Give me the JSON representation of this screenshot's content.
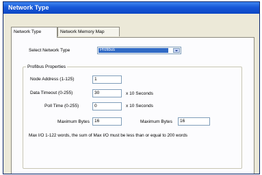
{
  "window": {
    "title": "Network Type"
  },
  "tabs": [
    {
      "label": "Network Type",
      "active": true
    },
    {
      "label": "Network Memory Map",
      "active": false
    }
  ],
  "select_network": {
    "label": "Select Network Type",
    "value": "Profibus"
  },
  "group": {
    "title": "Profibus Properties"
  },
  "fields": {
    "node_address": {
      "label": "Node Address (1-125)",
      "value": "1"
    },
    "data_timeout": {
      "label": "Data Timeout (0-255)",
      "value": "30",
      "unit": "x 10 Seconds"
    },
    "poll_time": {
      "label": "Poll Time (0-255)",
      "value": "0",
      "unit": "x 10 Seconds"
    },
    "max_bytes_in": {
      "label": "Maximum Bytes",
      "value": "16"
    },
    "max_bytes_out": {
      "label": "Maximum Bytes",
      "value": "16"
    }
  },
  "note": "Max I/O 1-122 words, the sum of Max I/O must be less than or equal to 200 words",
  "colors": {
    "titlebar": "#1758d8",
    "selection": "#316ac5",
    "window_bg": "#ece9d8"
  }
}
